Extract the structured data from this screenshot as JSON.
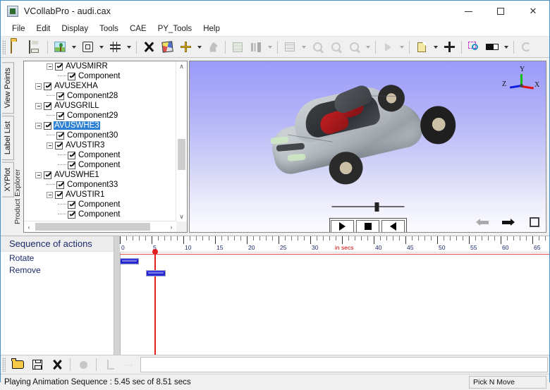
{
  "window": {
    "title": "VCollabPro - audi.cax",
    "icon": "app-icon",
    "controls": {
      "minimize": "—",
      "maximize": "□",
      "close": "✕"
    }
  },
  "menubar": {
    "items": [
      "File",
      "Edit",
      "Display",
      "Tools",
      "CAE",
      "PY_Tools",
      "Help"
    ]
  },
  "toolbar": {
    "groups": [
      {
        "buttons": [
          {
            "name": "open-icon",
            "glyph": "folder-open",
            "dropdown": false,
            "disabled": false
          },
          {
            "name": "save-icon",
            "glyph": "floppy",
            "dropdown": false,
            "disabled": false
          }
        ]
      },
      {
        "buttons": [
          {
            "name": "scene-tree-icon",
            "glyph": "tree-ic",
            "dropdown": true,
            "disabled": false
          },
          {
            "name": "fit-view-icon",
            "glyph": "fitbox",
            "dropdown": true,
            "disabled": false
          },
          {
            "name": "grid-icon",
            "glyph": "hash",
            "dropdown": true,
            "disabled": false
          }
        ]
      },
      {
        "buttons": [
          {
            "name": "explode-icon",
            "glyph": "xcross",
            "dropdown": false,
            "disabled": false
          },
          {
            "name": "render-cube-icon",
            "glyph": "cube3d",
            "dropdown": false,
            "disabled": false
          },
          {
            "name": "move-part-icon",
            "glyph": "plusmove",
            "dropdown": true,
            "disabled": false
          },
          {
            "name": "stamp-icon",
            "glyph": "stamp",
            "dropdown": false,
            "disabled": true
          }
        ]
      },
      {
        "buttons": [
          {
            "name": "section-stack-icon",
            "glyph": "stackbox",
            "dropdown": false,
            "disabled": true
          },
          {
            "name": "legend-bars-icon",
            "glyph": "barsicon",
            "dropdown": true,
            "disabled": true
          }
        ]
      },
      {
        "buttons": [
          {
            "name": "table-icon",
            "glyph": "tablesm",
            "dropdown": true,
            "disabled": true
          },
          {
            "name": "zoom-in-icon",
            "glyph": "magn",
            "dropdown": false,
            "disabled": true
          },
          {
            "name": "zoom-out-icon",
            "glyph": "magn",
            "dropdown": false,
            "disabled": true
          },
          {
            "name": "zoom-fit-icon",
            "glyph": "magn",
            "dropdown": true,
            "disabled": true
          }
        ]
      },
      {
        "buttons": [
          {
            "name": "play-animation-icon",
            "glyph": "playg",
            "dropdown": true,
            "disabled": true
          }
        ]
      },
      {
        "buttons": [
          {
            "name": "new-page-icon",
            "glyph": "pagey",
            "dropdown": true,
            "disabled": false
          },
          {
            "name": "pick-move-icon",
            "glyph": "movecross",
            "dropdown": false,
            "disabled": false
          }
        ]
      },
      {
        "buttons": [
          {
            "name": "zoom-window-icon",
            "glyph": "zoomsel",
            "dropdown": false,
            "disabled": false
          },
          {
            "name": "viewport-layout-icon",
            "glyph": "blackbar",
            "dropdown": true,
            "disabled": false
          }
        ]
      },
      {
        "buttons": [
          {
            "name": "refresh-icon",
            "glyph": "refresh",
            "dropdown": false,
            "disabled": true
          }
        ]
      }
    ]
  },
  "sidetabs": {
    "items": [
      {
        "label": "View Points",
        "selected": false
      },
      {
        "label": "Label List",
        "selected": false
      },
      {
        "label": "XYPlot",
        "selected": false
      }
    ],
    "ghost_label": "Product Explorer"
  },
  "tree": {
    "rows": [
      {
        "indent": 3,
        "expander": true,
        "label": "AVUSMIRR",
        "selected": false,
        "clipped": false
      },
      {
        "indent": 4,
        "expander": false,
        "label": "Component",
        "selected": false,
        "clipped": true
      },
      {
        "indent": 2,
        "expander": true,
        "label": "AVUSEXHA",
        "selected": false,
        "clipped": false
      },
      {
        "indent": 3,
        "expander": false,
        "label": "Component28",
        "selected": false,
        "clipped": false
      },
      {
        "indent": 2,
        "expander": true,
        "label": "AVUSGRILL",
        "selected": false,
        "clipped": false
      },
      {
        "indent": 3,
        "expander": false,
        "label": "Component29",
        "selected": false,
        "clipped": false
      },
      {
        "indent": 2,
        "expander": true,
        "label": "AVUSWHE3",
        "selected": true,
        "clipped": false
      },
      {
        "indent": 3,
        "expander": false,
        "label": "Component30",
        "selected": false,
        "clipped": false
      },
      {
        "indent": 3,
        "expander": true,
        "label": "AVUSTIR3",
        "selected": false,
        "clipped": false
      },
      {
        "indent": 4,
        "expander": false,
        "label": "Component",
        "selected": false,
        "clipped": true
      },
      {
        "indent": 4,
        "expander": false,
        "label": "Component",
        "selected": false,
        "clipped": true
      },
      {
        "indent": 2,
        "expander": true,
        "label": "AVUSWHE1",
        "selected": false,
        "clipped": false
      },
      {
        "indent": 3,
        "expander": false,
        "label": "Component33",
        "selected": false,
        "clipped": false
      },
      {
        "indent": 3,
        "expander": true,
        "label": "AVUSTIR1",
        "selected": false,
        "clipped": false
      },
      {
        "indent": 4,
        "expander": false,
        "label": "Component",
        "selected": false,
        "clipped": true
      },
      {
        "indent": 4,
        "expander": false,
        "label": "Component",
        "selected": false,
        "clipped": true
      }
    ],
    "scroll": {
      "up": "∧",
      "down": "∨",
      "left": "‹",
      "right": "›"
    }
  },
  "viewport": {
    "model": "audi-car-3d-model",
    "background_top": "#9a9afa",
    "background_bottom": "#fcfcff",
    "triad": {
      "x_label": "X",
      "y_label": "Y",
      "z_label": "Z",
      "x_color": "#e01010",
      "y_color": "#10c010",
      "z_color": "#1020e0"
    },
    "slider": {
      "value_pct": 61
    },
    "transport": [
      {
        "name": "play-button",
        "glyph": "play"
      },
      {
        "name": "stop-button",
        "glyph": "stop"
      },
      {
        "name": "reverse-button",
        "glyph": "reverse"
      }
    ],
    "nav": [
      {
        "name": "previous-view-button",
        "glyph": "arrow-left",
        "disabled": true
      },
      {
        "name": "next-view-button",
        "glyph": "arrow-right",
        "disabled": false
      },
      {
        "name": "fullscreen-button",
        "glyph": "expand",
        "disabled": false
      }
    ]
  },
  "sequence": {
    "header": "Sequence of actions",
    "rows": [
      {
        "label": "Rotate",
        "start_sec": 0.0,
        "end_sec": 3.0
      },
      {
        "label": "Remove",
        "start_sec": 4.1,
        "end_sec": 7.2
      }
    ],
    "ruler": {
      "unit_label": "in secs",
      "unit_label_at": 35,
      "min": 0,
      "max": 68,
      "major_step": 5,
      "minor_step": 1,
      "major_labels": [
        "0",
        "5",
        "10",
        "15",
        "20",
        "25",
        "30",
        "40",
        "45",
        "50",
        "55",
        "60",
        "65"
      ]
    },
    "playhead_sec": 5.45
  },
  "bottom_toolbar": {
    "buttons": [
      {
        "name": "open-sequence-icon",
        "glyph": "ofolder",
        "disabled": false
      },
      {
        "name": "save-sequence-icon",
        "glyph": "osave",
        "disabled": false
      },
      {
        "name": "delete-sequence-icon",
        "glyph": "oclose",
        "disabled": false
      },
      {
        "name": "record-icon",
        "glyph": "dot",
        "disabled": true
      },
      {
        "name": "axis-keyframe-icon",
        "glyph": "axisic",
        "disabled": true
      },
      {
        "name": "more-options-icon",
        "glyph": "ellipsis",
        "disabled": true
      }
    ]
  },
  "statusbar": {
    "message": "Playing Animation Sequence : 5.45 sec of 8.51 secs",
    "mode": "Pick N Move"
  }
}
